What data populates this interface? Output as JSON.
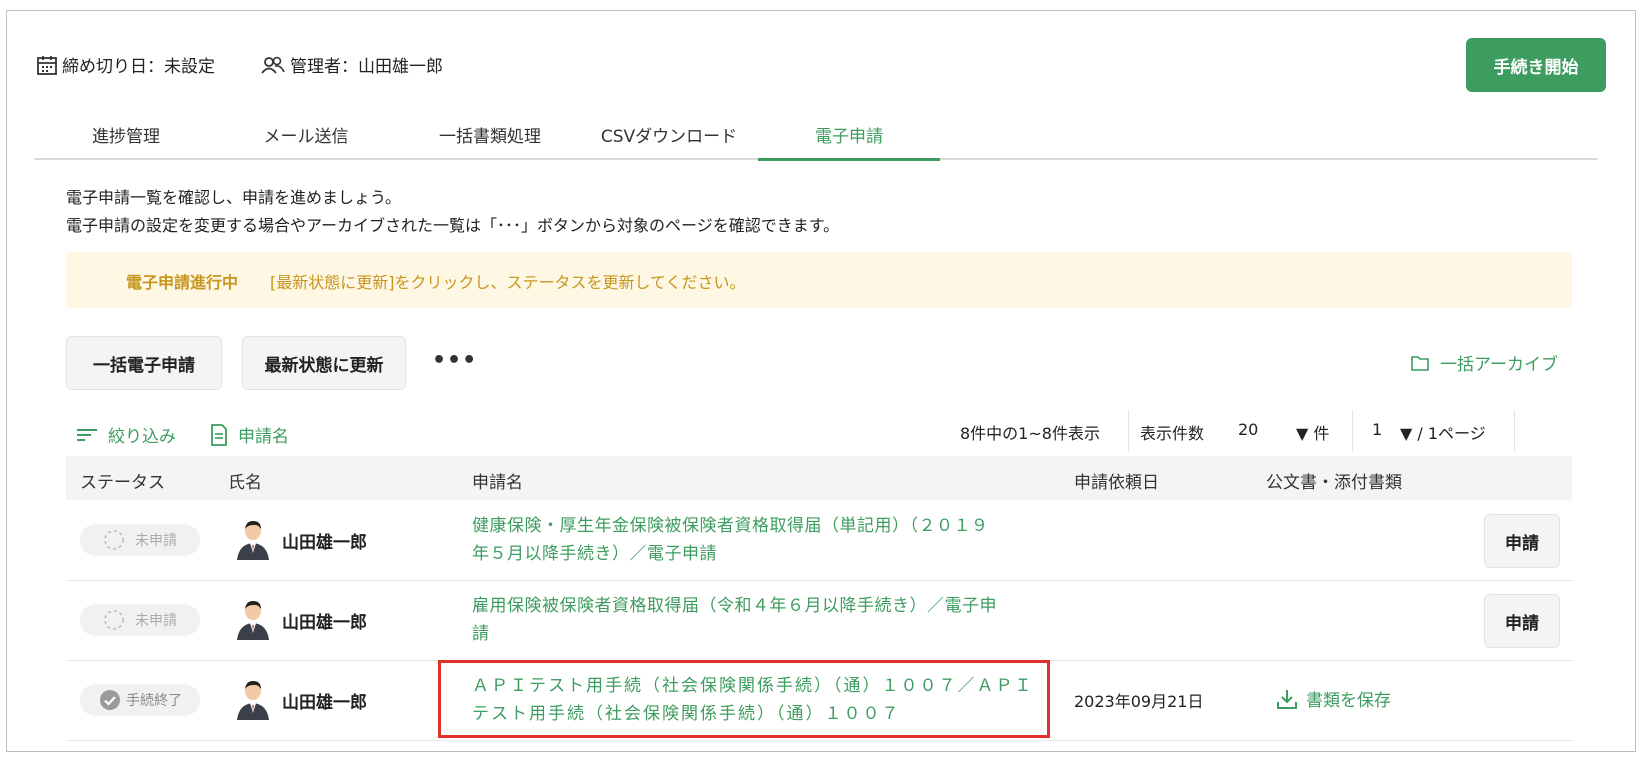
{
  "header": {
    "deadline": "締め切り日：未設定",
    "manager": "管理者：山田雄一郎",
    "start_button": "手続き開始"
  },
  "tabs": [
    {
      "label": "進捗管理",
      "active": false
    },
    {
      "label": "メール送信",
      "active": false
    },
    {
      "label": "一括書類処理",
      "active": false
    },
    {
      "label": "CSVダウンロード",
      "active": false
    },
    {
      "label": "電子申請",
      "active": true
    }
  ],
  "description": {
    "line1": "電子申請一覧を確認し、申請を進めましょう。",
    "line2": "電子申請の設定を変更する場合やアーカイブされた一覧は「･･･」ボタンから対象のページを確認できます。"
  },
  "notice": {
    "title": "電子申請進行中",
    "text": "[最新状態に更新]をクリックし、ステータスを更新してください。"
  },
  "actions": {
    "bulk_submit": "一括電子申請",
    "refresh": "最新状態に更新",
    "more": "•••",
    "archive": "一括アーカイブ"
  },
  "toolbar": {
    "filter": "絞り込み",
    "app_name": "申請名",
    "count_text": "8件中の1~8件表示",
    "per_page_label": "表示件数",
    "per_page_value": "20",
    "per_page_unit": "▼ 件",
    "page_value": "1",
    "page_suffix": "▼ / 1ページ"
  },
  "table": {
    "headers": [
      "ステータス",
      "氏名",
      "申請名",
      "申請依頼日",
      "公文書・添付書類"
    ],
    "rows": [
      {
        "status": "未申請",
        "name": "山田雄一郎",
        "app_line1": "健康保険・厚生年金保険被保険者資格取得届（単記用）（２０１９",
        "app_line2": "年５月以降手続き）／電子申請",
        "date": "",
        "action": "申請"
      },
      {
        "status": "未申請",
        "name": "山田雄一郎",
        "app_line1": "雇用保険被保険者資格取得届（令和４年６月以降手続き）／電子申",
        "app_line2": "請",
        "date": "",
        "action": "申請"
      },
      {
        "status": "手続終了",
        "name": "山田雄一郎",
        "app_line1": "ＡＰＩテスト用手続（社会保険関係手続）（通）１００７／ＡＰＩ",
        "app_line2": "テスト用手続（社会保険関係手続）（通）１００７",
        "date": "2023年09月21日",
        "action": "書類を保存"
      }
    ]
  },
  "colors": {
    "accent": "#3d9c5f",
    "notice_bg": "#fdf7e3",
    "notice_text": "#c8961e",
    "highlight_border": "#e0322a"
  }
}
